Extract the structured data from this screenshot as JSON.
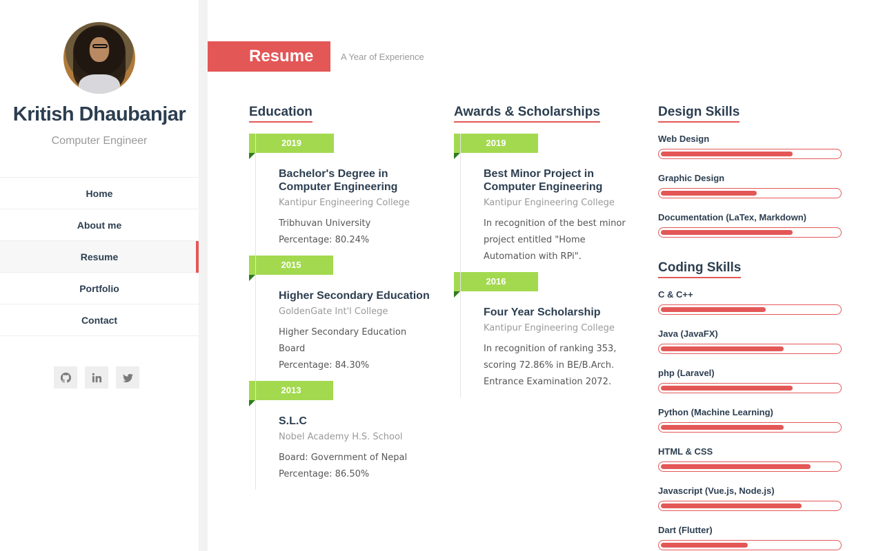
{
  "profile": {
    "name": "Kritish Dhaubanjar",
    "role": "Computer Engineer"
  },
  "nav": {
    "items": [
      "Home",
      "About me",
      "Resume",
      "Portfolio",
      "Contact"
    ],
    "active": "Resume"
  },
  "socials": [
    "github-icon",
    "linkedin-icon",
    "twitter-icon"
  ],
  "header": {
    "tag": "Resume",
    "subtitle": "A Year of Experience"
  },
  "colors": {
    "accent": "#e35757",
    "year": "#a3d94f",
    "text": "#2c3e50"
  },
  "education": {
    "title": "Education",
    "entries": [
      {
        "year": "2019",
        "title": "Bachelor's Degree in Computer Engineering",
        "school": "Kantipur Engineering College",
        "lines": [
          "Tribhuvan University",
          "Percentage: 80.24%"
        ]
      },
      {
        "year": "2015",
        "title": "Higher Secondary Education",
        "school": "GoldenGate Int'l College",
        "lines": [
          "Higher Secondary Education Board",
          "Percentage: 84.30%"
        ]
      },
      {
        "year": "2013",
        "title": "S.L.C",
        "school": "Nobel Academy H.S. School",
        "lines": [
          "Board: Government of Nepal",
          "Percentage: 86.50%"
        ]
      }
    ]
  },
  "awards": {
    "title": "Awards & Scholarships",
    "entries": [
      {
        "year": "2019",
        "title": "Best Minor Project in Computer Engineering",
        "school": "Kantipur Engineering College",
        "lines": [
          "In recognition of the best minor project entitled \"Home Automation with RPi\"."
        ]
      },
      {
        "year": "2016",
        "title": "Four Year Scholarship",
        "school": "Kantipur Engineering College",
        "lines": [
          "In recognition of ranking 353, scoring 72.86% in BE/B.Arch. Entrance Examination 2072."
        ]
      }
    ]
  },
  "design_skills": {
    "title": "Design Skills",
    "items": [
      {
        "name": "Web Design",
        "level": 0.74
      },
      {
        "name": "Graphic Design",
        "level": 0.54
      },
      {
        "name": "Documentation (LaTex, Markdown)",
        "level": 0.74
      }
    ]
  },
  "coding_skills": {
    "title": "Coding Skills",
    "items": [
      {
        "name": "C & C++",
        "level": 0.59
      },
      {
        "name": "Java (JavaFX)",
        "level": 0.69
      },
      {
        "name": "php (Laravel)",
        "level": 0.74
      },
      {
        "name": "Python (Machine Learning)",
        "level": 0.69
      },
      {
        "name": "HTML & CSS",
        "level": 0.84
      },
      {
        "name": "Javascript (Vue.js, Node.js)",
        "level": 0.79
      },
      {
        "name": "Dart (Flutter)",
        "level": 0.49
      }
    ]
  }
}
